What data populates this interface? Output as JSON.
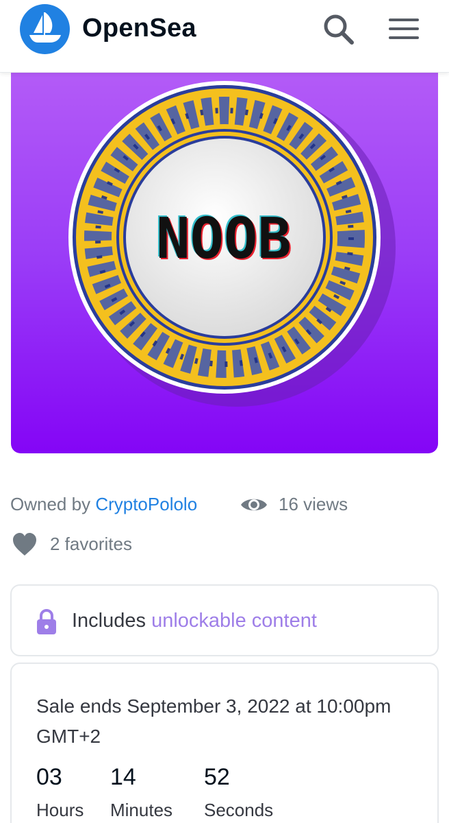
{
  "header": {
    "brand": "OpenSea",
    "icons": {
      "logo": "opensea-boat-logo",
      "search": "search-icon",
      "menu": "hamburger-menu-icon"
    },
    "colors": {
      "logo_bg": "#2081e2"
    }
  },
  "artwork": {
    "plate_text": "NOOB",
    "colors": {
      "background_top": "#b45cf7",
      "background_bottom": "#8405f6",
      "rim": "#f4c01e"
    }
  },
  "meta": {
    "owned_prefix": "Owned by",
    "owner": "CryptoPololo",
    "views": "16 views",
    "favorites": "2 favorites"
  },
  "unlockable": {
    "prefix": "Includes",
    "link": "unlockable content",
    "icon": "lock-icon"
  },
  "sale": {
    "ends_text": "Sale ends September 3, 2022 at 10:00pm GMT+2",
    "countdown": [
      {
        "value": "03",
        "label": "Hours"
      },
      {
        "value": "14",
        "label": "Minutes"
      },
      {
        "value": "52",
        "label": "Seconds"
      }
    ]
  }
}
